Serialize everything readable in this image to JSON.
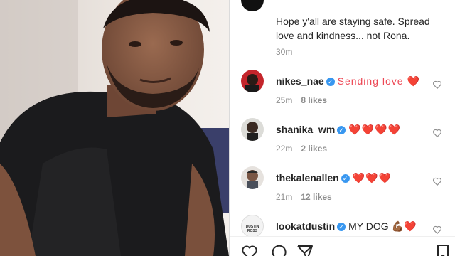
{
  "post": {
    "caption": "Hope y'all are staying safe. Spread love and kindness... not Rona.",
    "time": "30m"
  },
  "comments": [
    {
      "username": "nikes_nae",
      "verified": true,
      "text": "Sending love ❤️",
      "time": "25m",
      "likes": "8 likes"
    },
    {
      "username": "shanika_wm",
      "verified": true,
      "text": "❤️❤️❤️❤️",
      "time": "22m",
      "likes": "2 likes"
    },
    {
      "username": "thekalenallen",
      "verified": true,
      "text": "❤️❤️❤️",
      "time": "21m",
      "likes": "12 likes"
    },
    {
      "username": "lookatdustin",
      "verified": true,
      "text": "MY DOG 💪🏾❤️",
      "avatar_text": "DUSTIN ROSS"
    }
  ],
  "icons": {
    "comment_like": "heart-outline-icon",
    "actions": [
      "heart-outline-icon",
      "comment-bubble-icon",
      "share-paper-plane-icon",
      "bookmark-icon"
    ]
  },
  "colors": {
    "verified": "#3897f0",
    "heart": "#ed4956",
    "meta": "#8e8e8e",
    "text": "#262626"
  }
}
